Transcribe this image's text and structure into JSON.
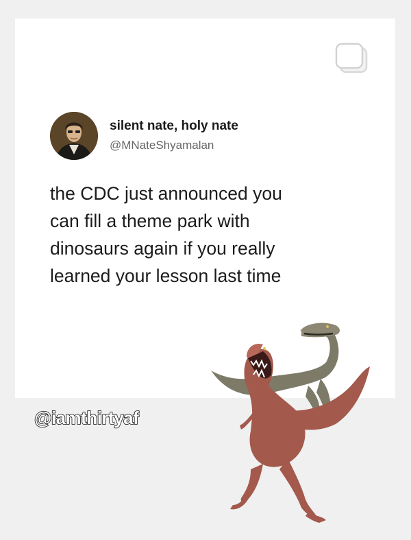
{
  "post": {
    "author_name": "silent nate, holy nate",
    "author_handle": "@MNateShyamalan",
    "text_lines": [
      "the CDC just announced you",
      "can fill a theme park with",
      "dinosaurs again if you really",
      "learned your lesson last time"
    ]
  },
  "watermark": "@iamthirtyaf",
  "icons": {
    "top_right": "copy-icon",
    "avatar": "avatar-portrait",
    "illustration": "velociraptors-illustration"
  },
  "colors": {
    "background": "#f0f0f0",
    "card": "#ffffff",
    "name_text": "#1a1a1a",
    "handle_text": "#666666",
    "raptor_red": "#a3594c",
    "raptor_grey": "#7d7a68"
  }
}
